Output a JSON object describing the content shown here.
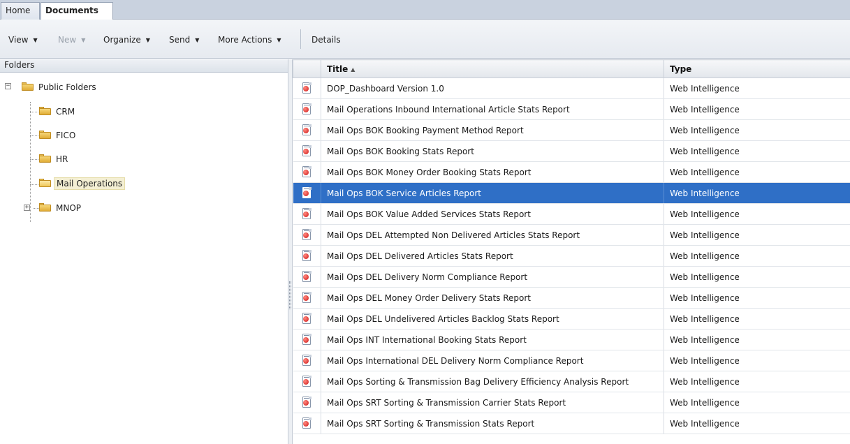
{
  "tabs": [
    {
      "label": "Home"
    },
    {
      "label": "Documents"
    }
  ],
  "toolbar": {
    "view": "View",
    "new": "New",
    "organize": "Organize",
    "send": "Send",
    "more_actions": "More Actions",
    "details": "Details",
    "dropdown_arrow": "▼"
  },
  "folders_pane": {
    "header": "Folders",
    "tree": {
      "root": "Public Folders",
      "children": [
        "CRM",
        "FICO",
        "HR",
        "Mail Operations",
        "MNOP"
      ],
      "selected": "Mail Operations"
    }
  },
  "documents": {
    "columns": {
      "title": "Title",
      "type": "Type",
      "sort_indicator": "▲"
    },
    "rows": [
      {
        "title": "DOP_Dashboard Version 1.0",
        "type": "Web Intelligence"
      },
      {
        "title": "Mail Operations Inbound International Article Stats Report",
        "type": "Web Intelligence"
      },
      {
        "title": "Mail Ops BOK Booking Payment Method Report",
        "type": "Web Intelligence"
      },
      {
        "title": "Mail Ops BOK Booking Stats Report",
        "type": "Web Intelligence"
      },
      {
        "title": "Mail Ops BOK Money Order Booking Stats Report",
        "type": "Web Intelligence"
      },
      {
        "title": "Mail Ops BOK Service Articles Report",
        "type": "Web Intelligence"
      },
      {
        "title": "Mail Ops BOK Value Added Services Stats Report",
        "type": "Web Intelligence"
      },
      {
        "title": "Mail Ops DEL Attempted Non Delivered Articles Stats Report",
        "type": "Web Intelligence"
      },
      {
        "title": "Mail Ops DEL Delivered Articles Stats Report",
        "type": "Web Intelligence"
      },
      {
        "title": "Mail Ops DEL Delivery Norm Compliance Report",
        "type": "Web Intelligence"
      },
      {
        "title": "Mail Ops DEL Money Order Delivery Stats Report",
        "type": "Web Intelligence"
      },
      {
        "title": "Mail Ops DEL Undelivered Articles Backlog Stats Report",
        "type": "Web Intelligence"
      },
      {
        "title": "Mail Ops INT International Booking Stats Report",
        "type": "Web Intelligence"
      },
      {
        "title": "Mail Ops International DEL Delivery Norm Compliance Report",
        "type": "Web Intelligence"
      },
      {
        "title": "Mail Ops Sorting & Transmission Bag Delivery Efficiency Analysis Report",
        "type": "Web Intelligence"
      },
      {
        "title": "Mail Ops SRT Sorting & Transmission Carrier Stats Report",
        "type": "Web Intelligence"
      },
      {
        "title": "Mail Ops SRT Sorting & Transmission Stats Report",
        "type": "Web Intelligence"
      }
    ],
    "selected_index": 5
  },
  "colors": {
    "selection": "#2f6fc6",
    "tree_selection": "#f4efd3",
    "tab_bar": "#c9d2df"
  },
  "icons": {
    "document": "web-intelligence-document-icon",
    "folder": "folder-icon",
    "expand": "+",
    "collapse": "−"
  }
}
